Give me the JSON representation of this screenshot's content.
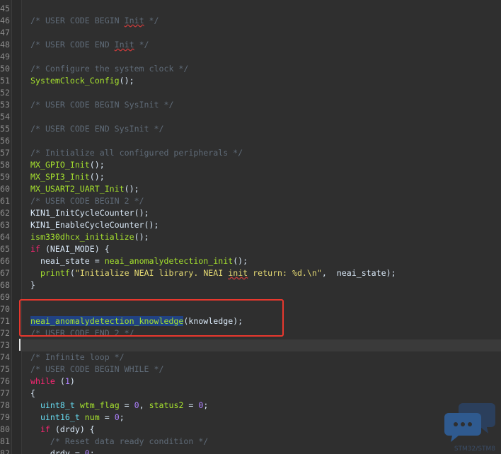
{
  "editor": {
    "lines": [
      {
        "num": "46",
        "tokens": [
          {
            "t": "/* USER CODE BEGIN ",
            "c": "comment"
          },
          {
            "t": "Init",
            "c": "comment squiggle"
          },
          {
            "t": " */",
            "c": "comment"
          }
        ]
      },
      {
        "num": "47",
        "tokens": []
      },
      {
        "num": "48",
        "tokens": [
          {
            "t": "/* USER CODE END ",
            "c": "comment"
          },
          {
            "t": "Init",
            "c": "comment squiggle"
          },
          {
            "t": " */",
            "c": "comment"
          }
        ]
      },
      {
        "num": "49",
        "tokens": []
      },
      {
        "num": "50",
        "tokens": [
          {
            "t": "/* Configure the system clock */",
            "c": "comment"
          }
        ]
      },
      {
        "num": "51",
        "tokens": [
          {
            "t": "SystemClock_Config",
            "c": "fn"
          },
          {
            "t": "();",
            "c": "plain"
          }
        ]
      },
      {
        "num": "52",
        "tokens": []
      },
      {
        "num": "53",
        "tokens": [
          {
            "t": "/* USER CODE BEGIN SysInit */",
            "c": "comment"
          }
        ]
      },
      {
        "num": "54",
        "tokens": []
      },
      {
        "num": "55",
        "tokens": [
          {
            "t": "/* USER CODE END SysInit */",
            "c": "comment"
          }
        ]
      },
      {
        "num": "56",
        "tokens": []
      },
      {
        "num": "57",
        "tokens": [
          {
            "t": "/* Initialize all configured peripherals */",
            "c": "comment"
          }
        ]
      },
      {
        "num": "58",
        "tokens": [
          {
            "t": "MX_GPIO_Init",
            "c": "fn"
          },
          {
            "t": "();",
            "c": "plain"
          }
        ]
      },
      {
        "num": "59",
        "tokens": [
          {
            "t": "MX_SPI3_Init",
            "c": "fn"
          },
          {
            "t": "();",
            "c": "plain"
          }
        ]
      },
      {
        "num": "60",
        "tokens": [
          {
            "t": "MX_USART2_UART_Init",
            "c": "fn"
          },
          {
            "t": "();",
            "c": "plain"
          }
        ]
      },
      {
        "num": "61",
        "tokens": [
          {
            "t": "/* USER CODE BEGIN 2 */",
            "c": "comment"
          }
        ]
      },
      {
        "num": "62",
        "tokens": [
          {
            "t": "KIN1_InitCycleCounter",
            "c": "plain"
          },
          {
            "t": "();",
            "c": "plain"
          }
        ]
      },
      {
        "num": "63",
        "tokens": [
          {
            "t": "KIN1_EnableCycleCounter",
            "c": "plain"
          },
          {
            "t": "();",
            "c": "plain"
          }
        ]
      },
      {
        "num": "64",
        "tokens": [
          {
            "t": "ism330dhcx_initialize",
            "c": "fn"
          },
          {
            "t": "();",
            "c": "plain"
          }
        ]
      },
      {
        "num": "65",
        "tokens": [
          {
            "t": "if",
            "c": "kw"
          },
          {
            "t": " (NEAI_MODE) {",
            "c": "plain"
          }
        ]
      },
      {
        "num": "66",
        "tokens": [
          {
            "t": "  neai_state = ",
            "c": "plain"
          },
          {
            "t": "neai_anomalydetection_init",
            "c": "fn"
          },
          {
            "t": "();",
            "c": "plain"
          }
        ]
      },
      {
        "num": "67",
        "tokens": [
          {
            "t": "  ",
            "c": "plain"
          },
          {
            "t": "printf",
            "c": "fn"
          },
          {
            "t": "(",
            "c": "plain"
          },
          {
            "t": "\"Initialize NEAI library. NEAI ",
            "c": "str"
          },
          {
            "t": "init",
            "c": "str squiggle"
          },
          {
            "t": " return: %d.\\n\"",
            "c": "str"
          },
          {
            "t": ",  neai_state);",
            "c": "plain"
          }
        ]
      },
      {
        "num": "68",
        "tokens": [
          {
            "t": "}",
            "c": "plain"
          }
        ]
      },
      {
        "num": "69",
        "tokens": []
      },
      {
        "num": "70",
        "tokens": []
      },
      {
        "num": "71",
        "tokens": [
          {
            "t": "neai_anomalydetection_knowledge",
            "c": "sel"
          },
          {
            "t": "(knowledge);",
            "c": "plain"
          }
        ]
      },
      {
        "num": "72",
        "tokens": [
          {
            "t": "/* USER CODE END 2 */",
            "c": "comment"
          }
        ]
      },
      {
        "num": "73",
        "tokens": [],
        "current": true
      },
      {
        "num": "74",
        "tokens": [
          {
            "t": "/* Infinite loop */",
            "c": "comment"
          }
        ]
      },
      {
        "num": "75",
        "tokens": [
          {
            "t": "/* USER CODE BEGIN WHILE */",
            "c": "comment"
          }
        ]
      },
      {
        "num": "76",
        "tokens": [
          {
            "t": "while",
            "c": "kw"
          },
          {
            "t": " (",
            "c": "plain"
          },
          {
            "t": "1",
            "c": "num"
          },
          {
            "t": ")",
            "c": "plain"
          }
        ]
      },
      {
        "num": "77",
        "tokens": [
          {
            "t": "{",
            "c": "plain"
          }
        ]
      },
      {
        "num": "78",
        "tokens": [
          {
            "t": "  ",
            "c": "plain"
          },
          {
            "t": "uint8_t",
            "c": "ty"
          },
          {
            "t": " ",
            "c": "plain"
          },
          {
            "t": "wtm_flag",
            "c": "fn"
          },
          {
            "t": " = ",
            "c": "plain"
          },
          {
            "t": "0",
            "c": "num"
          },
          {
            "t": ", ",
            "c": "plain"
          },
          {
            "t": "status2",
            "c": "fn"
          },
          {
            "t": " = ",
            "c": "plain"
          },
          {
            "t": "0",
            "c": "num"
          },
          {
            "t": ";",
            "c": "plain"
          }
        ]
      },
      {
        "num": "79",
        "tokens": [
          {
            "t": "  ",
            "c": "plain"
          },
          {
            "t": "uint16_t",
            "c": "ty"
          },
          {
            "t": " ",
            "c": "plain"
          },
          {
            "t": "num",
            "c": "fn"
          },
          {
            "t": " = ",
            "c": "plain"
          },
          {
            "t": "0",
            "c": "num"
          },
          {
            "t": ";",
            "c": "plain"
          }
        ]
      },
      {
        "num": "80",
        "tokens": [
          {
            "t": "  ",
            "c": "plain"
          },
          {
            "t": "if",
            "c": "kw"
          },
          {
            "t": " (drdy) {",
            "c": "plain"
          }
        ]
      },
      {
        "num": "81",
        "tokens": [
          {
            "t": "    /* Reset data ready condition */",
            "c": "comment"
          }
        ]
      },
      {
        "num": "82",
        "tokens": [
          {
            "t": "    drdy = ",
            "c": "plain"
          },
          {
            "t": "0",
            "c": "num"
          },
          {
            "t": ";",
            "c": "plain"
          }
        ]
      }
    ]
  },
  "colors": {
    "background": "#2f2f2f",
    "comment": "#5f6b78",
    "function": "#a6e22e",
    "keyword": "#f92672",
    "annotation_box": "#e8382e"
  },
  "watermark": {
    "icon": "chat-bubbles-icon",
    "text": "STM32/STM8"
  }
}
